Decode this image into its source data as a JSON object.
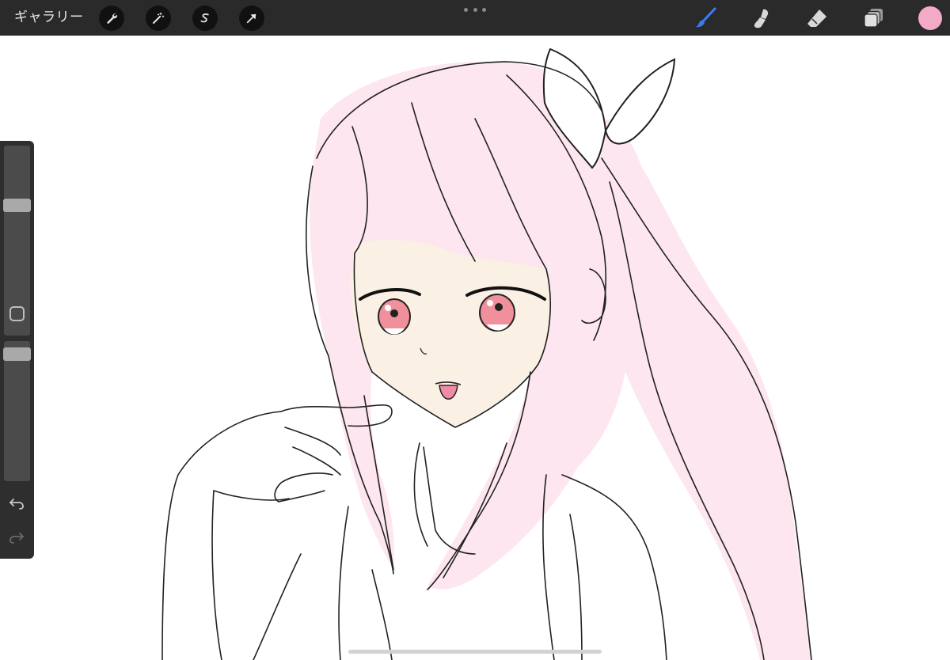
{
  "toolbar": {
    "gallery_label": "ギャラリー",
    "left_tools": [
      {
        "icon": "wrench-icon",
        "name": "actions-button"
      },
      {
        "icon": "magic-wand-icon",
        "name": "adjustments-button"
      },
      {
        "icon": "selection-s-icon",
        "name": "selection-button"
      },
      {
        "icon": "arrow-cursor-icon",
        "name": "transform-button"
      }
    ],
    "right_tools": [
      {
        "icon": "brush-icon",
        "name": "brush-tool-button",
        "active": true
      },
      {
        "icon": "smudge-icon",
        "name": "smudge-tool-button"
      },
      {
        "icon": "eraser-icon",
        "name": "eraser-tool-button"
      },
      {
        "icon": "layers-icon",
        "name": "layers-button"
      }
    ],
    "current_color": "#f4aac6",
    "accent_color": "#3a7bf0"
  },
  "sidebar": {
    "brush_size_level": 0.7,
    "opacity_level": 0.95,
    "icons": [
      "modify-square-icon",
      "undo-icon",
      "redo-icon"
    ]
  },
  "canvas": {
    "hair_color": "#fde6ef",
    "skin_color": "#fbf0e4",
    "eye_color": "#f0909c",
    "tongue_color": "#f08aa6"
  }
}
